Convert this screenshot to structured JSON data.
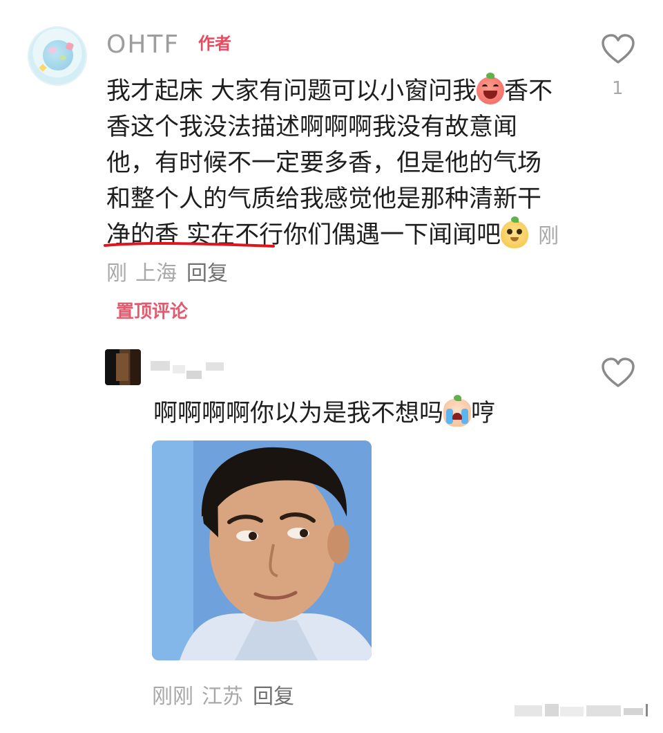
{
  "comment1": {
    "username": "OHTF",
    "author_badge": "作者",
    "text_part1": "我才起床 大家有问题可以小窗问我",
    "emoji1": "laughing-peach-emoji",
    "text_part2": "香不香这个我没法描述啊啊啊我没有故意闻他，有时候不一定要多香，但是他的气场和整个人的气质给我感觉他是那种",
    "text_underlined": "清新干净的香",
    "text_part3": " 实在不行你们偶遇一下闻闻吧",
    "emoji2": "doge-emoji",
    "time": "刚刚",
    "location": "上海",
    "reply_label": "回复",
    "like_count": "1",
    "pinned_label": "置顶评论",
    "underline_color": "#e0161e"
  },
  "comment2": {
    "text_part1": "啊啊啊啊你以为是我不想吗",
    "emoji": "crying-emoji",
    "text_part2": "哼",
    "image": "man-side-eye-meme-photo",
    "time": "刚刚",
    "location": "江苏",
    "reply_label": "回复"
  },
  "colors": {
    "author_badge": "#e84b5e",
    "pinned": "#e25a6e",
    "meta_gray": "#a8a8a8"
  }
}
